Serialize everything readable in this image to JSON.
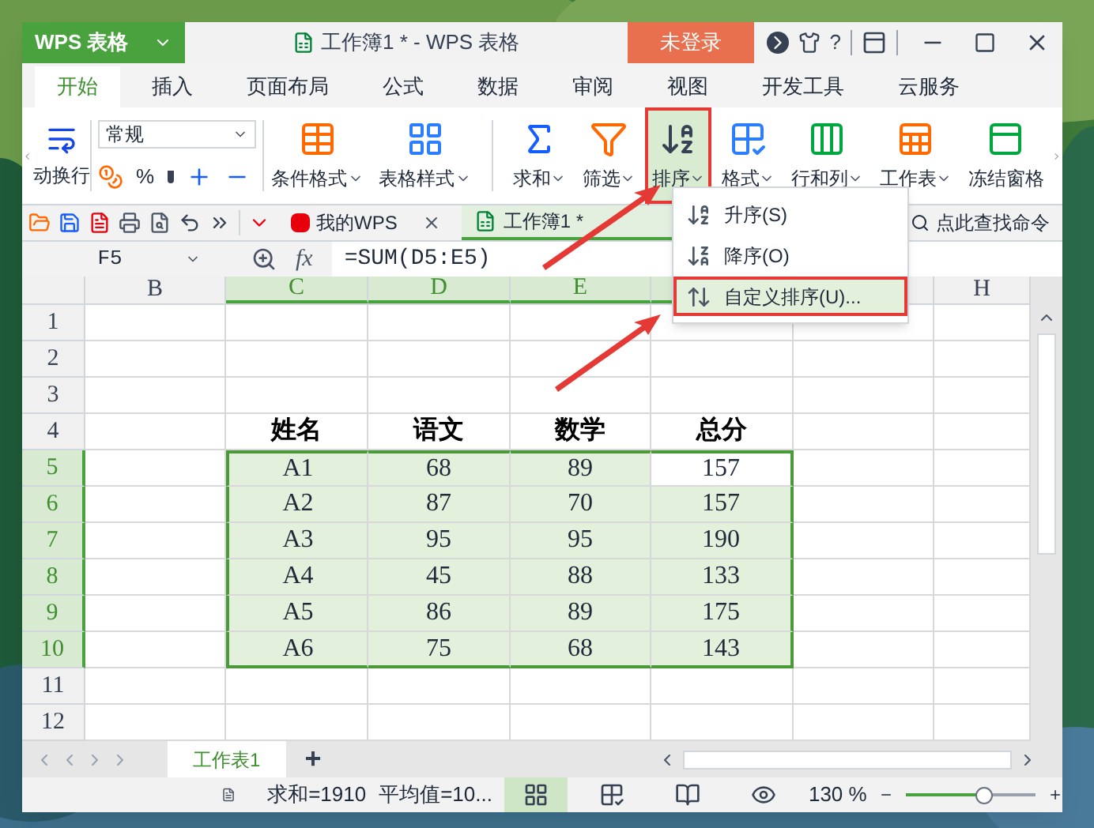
{
  "window": {
    "app_name": "WPS 表格",
    "title": "工作簿1 * - WPS 表格",
    "login_button": "未登录",
    "help": "?"
  },
  "ribbon_tabs": [
    {
      "label": "开始",
      "selected": true
    },
    {
      "label": "插入",
      "selected": false
    },
    {
      "label": "页面布局",
      "selected": false
    },
    {
      "label": "公式",
      "selected": false
    },
    {
      "label": "数据",
      "selected": false
    },
    {
      "label": "审阅",
      "selected": false
    },
    {
      "label": "视图",
      "selected": false
    },
    {
      "label": "开发工具",
      "selected": false
    },
    {
      "label": "云服务",
      "selected": false
    }
  ],
  "ribbon": {
    "wrap_label": "动换行",
    "number_format": "常规",
    "percent": "%",
    "buttons": [
      {
        "kind": "conditional",
        "label": "条件格式",
        "pressed": false
      },
      {
        "kind": "table_style",
        "label": "表格样式",
        "pressed": false
      },
      {
        "kind": "sum",
        "label": "求和",
        "pressed": false
      },
      {
        "kind": "filter",
        "label": "筛选",
        "pressed": false
      },
      {
        "kind": "sort",
        "label": "排序",
        "pressed": true,
        "framed": true
      },
      {
        "kind": "format",
        "label": "格式",
        "pressed": false
      },
      {
        "kind": "rows_cols",
        "label": "行和列",
        "pressed": false
      },
      {
        "kind": "worksheet",
        "label": "工作表",
        "pressed": false
      },
      {
        "kind": "freeze",
        "label": "冻结窗格",
        "pressed": false
      }
    ]
  },
  "doc_tabs": [
    {
      "kind": "home",
      "label": "我的WPS",
      "selected": false,
      "closable": true
    },
    {
      "kind": "sheet",
      "label": "工作簿1 *",
      "selected": true,
      "closable": false
    }
  ],
  "command_search": {
    "placeholder": "点此查找命令"
  },
  "formula_bar": {
    "name_box": "F5",
    "fx": "fx",
    "formula": "=SUM(D5:E5)"
  },
  "sheet": {
    "columns": [
      {
        "label": "B",
        "selected": false
      },
      {
        "label": "C",
        "selected": true
      },
      {
        "label": "D",
        "selected": true
      },
      {
        "label": "E",
        "selected": true
      },
      {
        "selected": true
      },
      {
        "selected": false
      },
      {
        "label": "H",
        "selected": false
      }
    ],
    "rows": [
      {
        "label": "1",
        "selected": false,
        "cells": [
          null,
          null,
          null,
          null,
          null,
          null,
          null
        ]
      },
      {
        "label": "2",
        "selected": false,
        "cells": [
          null,
          null,
          null,
          null,
          null,
          null,
          null
        ]
      },
      {
        "label": "3",
        "selected": false,
        "cells": [
          null,
          null,
          null,
          null,
          null,
          null,
          null
        ]
      },
      {
        "label": "4",
        "selected": false,
        "header": true,
        "cells": [
          null,
          {
            "text": "姓名"
          },
          {
            "text": "语文"
          },
          {
            "text": "数学"
          },
          {
            "text": "总分"
          },
          null,
          null
        ]
      },
      {
        "label": "5",
        "selected": true,
        "cells": [
          null,
          {
            "text": "A1"
          },
          {
            "text": "68"
          },
          {
            "text": "89"
          },
          {
            "text": "157",
            "active": true
          },
          null,
          null
        ]
      },
      {
        "label": "6",
        "selected": true,
        "cells": [
          null,
          {
            "text": "A2"
          },
          {
            "text": "87"
          },
          {
            "text": "70"
          },
          {
            "text": "157"
          },
          null,
          null
        ]
      },
      {
        "label": "7",
        "selected": true,
        "cells": [
          null,
          {
            "text": "A3"
          },
          {
            "text": "95"
          },
          {
            "text": "95"
          },
          {
            "text": "190"
          },
          null,
          null
        ]
      },
      {
        "label": "8",
        "selected": true,
        "cells": [
          null,
          {
            "text": "A4"
          },
          {
            "text": "45"
          },
          {
            "text": "88"
          },
          {
            "text": "133"
          },
          null,
          null
        ]
      },
      {
        "label": "9",
        "selected": true,
        "cells": [
          null,
          {
            "text": "A5"
          },
          {
            "text": "86"
          },
          {
            "text": "89"
          },
          {
            "text": "175"
          },
          null,
          null
        ]
      },
      {
        "label": "10",
        "selected": true,
        "cells": [
          null,
          {
            "text": "A6"
          },
          {
            "text": "75"
          },
          {
            "text": "68"
          },
          {
            "text": "143"
          },
          null,
          null
        ]
      },
      {
        "label": "11",
        "selected": false,
        "cells": [
          null,
          null,
          null,
          null,
          null,
          null,
          null
        ]
      },
      {
        "label": "12",
        "selected": false,
        "cells": [
          null,
          null,
          null,
          null,
          null,
          null,
          null
        ]
      }
    ]
  },
  "sort_menu": [
    {
      "kind": "asc",
      "label": "升序(S)",
      "highlighted": false
    },
    {
      "kind": "desc",
      "label": "降序(O)",
      "highlighted": false
    },
    {
      "kind": "custom",
      "label": "自定义排序(U)...",
      "highlighted": true,
      "framed": true
    }
  ],
  "sheet_tabs": [
    {
      "label": "工作表1",
      "selected": true
    }
  ],
  "add_sheet": "+",
  "status_bar": {
    "sum": "求和=1910",
    "average": "平均值=10...",
    "views": [
      {
        "kind": "normal",
        "selected": true
      },
      {
        "kind": "page_break",
        "selected": false
      },
      {
        "kind": "reading",
        "selected": false
      },
      {
        "kind": "eye",
        "selected": false
      }
    ],
    "zoom": "130 %",
    "zoom_slider": {
      "level": 0.6
    }
  }
}
